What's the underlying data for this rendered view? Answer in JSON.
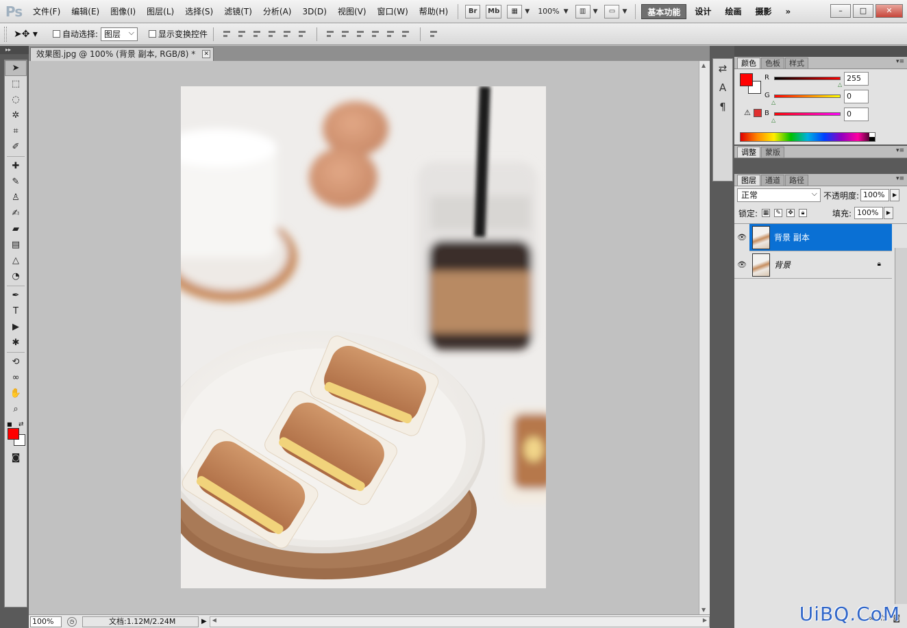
{
  "app": {
    "logo": "Ps"
  },
  "menus": [
    "文件(F)",
    "编辑(E)",
    "图像(I)",
    "图层(L)",
    "选择(S)",
    "滤镜(T)",
    "分析(A)",
    "3D(D)",
    "视图(V)",
    "窗口(W)",
    "帮助(H)"
  ],
  "menubar": {
    "br": "Br",
    "mb": "Mb",
    "zoom": "100%"
  },
  "workspaces": [
    "基本功能",
    "设计",
    "绘画",
    "摄影"
  ],
  "workspace_more": "»",
  "window_buttons": {
    "min": "–",
    "max": "□",
    "close": "✕"
  },
  "options": {
    "auto_select_label": "自动选择:",
    "auto_select_value": "图层",
    "show_transform_label": "显示变换控件"
  },
  "document": {
    "tab_title": "效果图.jpg @ 100% (背景 副本, RGB/8) *",
    "close": "✕"
  },
  "status": {
    "zoom": "100%",
    "doc_info": "文档:1.12M/2.24M",
    "play": "▶"
  },
  "color_panel": {
    "tabs": [
      "颜色",
      "色板",
      "样式"
    ],
    "sliders": [
      {
        "label": "R",
        "value": "255",
        "gradient": "linear-gradient(90deg,#000,#ff0000)",
        "pos": 1.0
      },
      {
        "label": "G",
        "value": "0",
        "gradient": "linear-gradient(90deg,#ff0000,#ffff00)",
        "pos": 0.0
      },
      {
        "label": "B",
        "value": "0",
        "gradient": "linear-gradient(90deg,#ff0000,#ff00ff)",
        "pos": 0.0
      }
    ],
    "foreground": "#ff0000",
    "background": "#ffffff"
  },
  "adjust_tabs": [
    "调整",
    "蒙版"
  ],
  "layers_panel": {
    "tabs": [
      "图层",
      "通道",
      "路径"
    ],
    "blend_mode": "正常",
    "opacity_label": "不透明度:",
    "opacity": "100%",
    "lock_label": "锁定:",
    "fill_label": "填充:",
    "fill": "100%",
    "layers": [
      {
        "name": "背景 副本",
        "selected": true,
        "locked": false
      },
      {
        "name": "背景",
        "selected": false,
        "locked": true
      }
    ]
  },
  "watermark": "UiBQ.CoM"
}
